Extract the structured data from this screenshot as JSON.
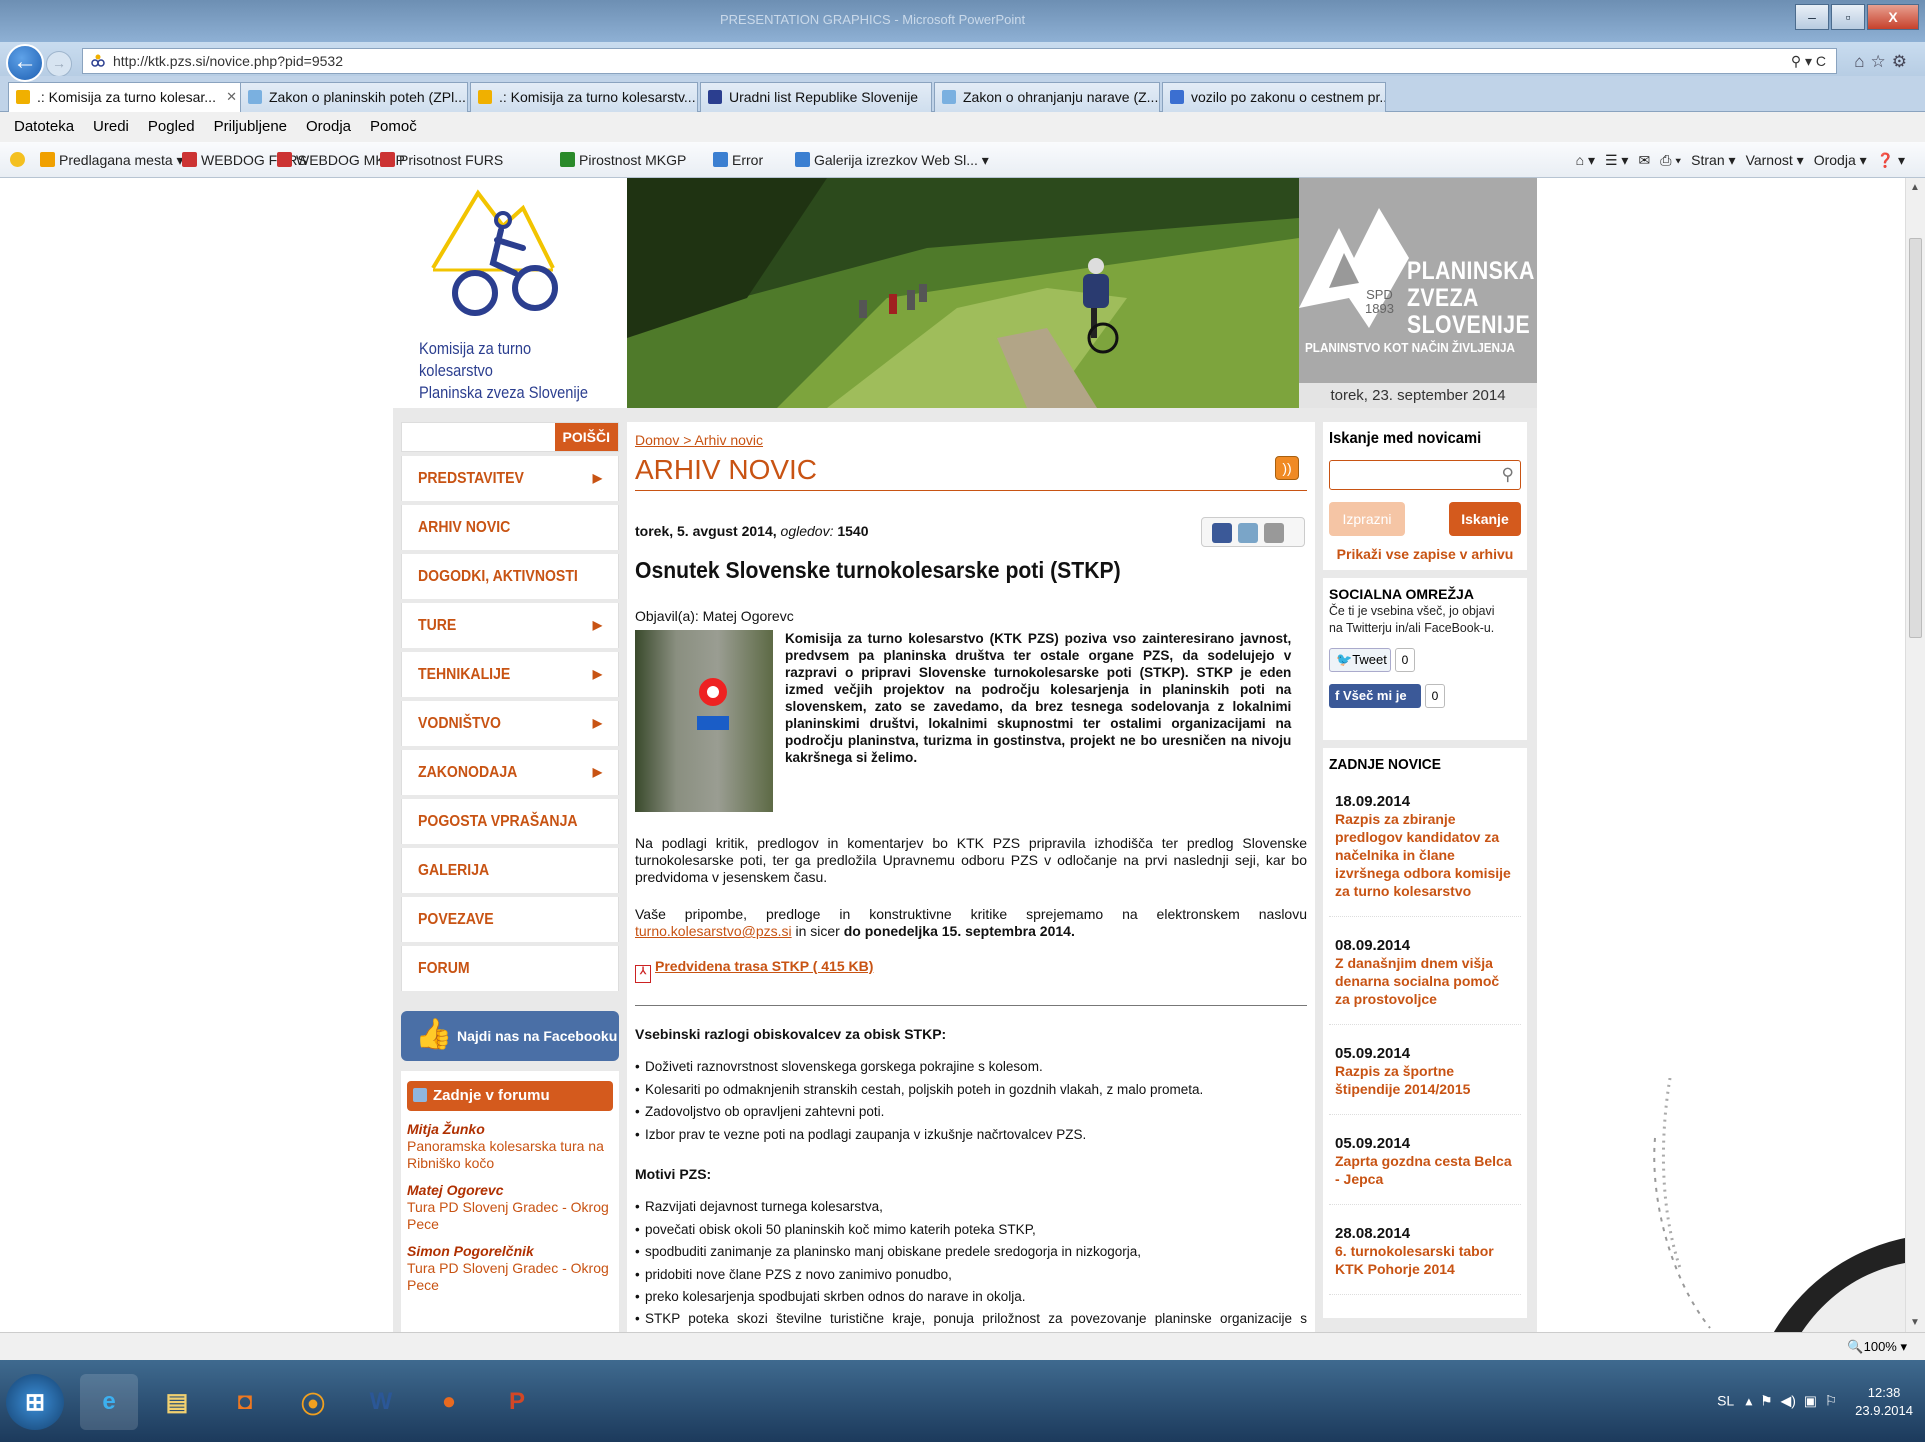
{
  "window": {
    "title": "PRESENTATION GRAPHICS - Microsoft PowerPoint"
  },
  "address": {
    "url": "http://ktk.pzs.si/novice.php?pid=9532",
    "controls": "⚲ ▾ C"
  },
  "tabs": [
    {
      "label": ".: Komisija za turno kolesar...",
      "color": "#f0b000"
    },
    {
      "label": "Zakon o planinskih poteh (ZPl...",
      "color": "#7ab0e0"
    },
    {
      "label": ".: Komisija za turno kolesarstv...",
      "color": "#f0b000"
    },
    {
      "label": "Uradni list Republike Slovenije",
      "color": "#2b3e8f"
    },
    {
      "label": "Zakon o ohranjanju narave (Z...",
      "color": "#7ab0e0"
    },
    {
      "label": "vozilo po zakonu o cestnem pr...",
      "color": "#3b6fd1"
    }
  ],
  "menubar": [
    "Datoteka",
    "Uredi",
    "Pogled",
    "Priljubljene",
    "Orodja",
    "Pomoč"
  ],
  "favorites": [
    {
      "label": "Predlagana mesta ▾",
      "color": "#f0a000"
    },
    {
      "label": "WEBDOG FURS",
      "color": "#c33"
    },
    {
      "label": "WEBDOG MKGP",
      "color": "#c33"
    },
    {
      "label": "Prisotnost FURS",
      "color": "#c33"
    },
    {
      "label": "Pirostnost MKGP",
      "color": "#2a8a2a"
    },
    {
      "label": "Error",
      "color": "#3b7fd1"
    },
    {
      "label": "Galerija izrezkov Web Sl... ▾",
      "color": "#3b7fd1"
    }
  ],
  "toolbar_right": [
    "⌂ ▾",
    "☰ ▾",
    "✉",
    "⎙ ▾",
    "Stran ▾",
    "Varnost ▾",
    "Orodja ▾",
    "❓ ▾"
  ],
  "site": {
    "logo_line1": "Komisija za turno kolesarstvo",
    "logo_line2": "Planinska zveza Slovenije",
    "pzs_name": [
      "PLANINSKA",
      "ZVEZA",
      "SLOVENIJE"
    ],
    "spd": [
      "SPD",
      "1893"
    ],
    "pzs_slogan": "PLANINSTVO KOT NAČIN ŽIVLJENJA",
    "date": "torek, 23. september 2014",
    "search_button": "POIŠČI",
    "nav": [
      {
        "label": "PREDSTAVITEV",
        "arrow": "▶"
      },
      {
        "label": "ARHIV NOVIC",
        "arrow": ""
      },
      {
        "label": "DOGODKI, AKTIVNOSTI",
        "arrow": ""
      },
      {
        "label": "TURE",
        "arrow": "▶"
      },
      {
        "label": "TEHNIKALIJE",
        "arrow": "▶"
      },
      {
        "label": "VODNIŠTVO",
        "arrow": "▶"
      },
      {
        "label": "ZAKONODAJA",
        "arrow": "▶"
      },
      {
        "label": "POGOSTA VPRAŠANJA",
        "arrow": ""
      },
      {
        "label": "GALERIJA",
        "arrow": ""
      },
      {
        "label": "POVEZAVE",
        "arrow": ""
      },
      {
        "label": "FORUM",
        "arrow": ""
      }
    ],
    "facebook_box": "Najdi nas na Facebooku",
    "forum": {
      "title": "Zadnje v forumu",
      "posts": [
        {
          "author": "Mitja Žunko",
          "topic": [
            "Panoramska kolesarska tura na",
            "Ribniško kočo"
          ]
        },
        {
          "author": "Matej Ogorevc",
          "topic": [
            "Tura PD Slovenj Gradec - Okrog",
            "Pece"
          ]
        },
        {
          "author": "Simon Pogorelčnik",
          "topic": [
            "Tura PD Slovenj Gradec - Okrog",
            "Pece"
          ]
        }
      ]
    }
  },
  "article": {
    "breadcrumb_home": "Domov",
    "breadcrumb_sep": " > ",
    "breadcrumb_current": "Arhiv novic",
    "heading": "ARHIV NOVIC",
    "date": "torek, 5. avgust 2014",
    "views_label": "ogledov:",
    "views": "1540",
    "title": "Osnutek Slovenske turnokolesarske poti (STKP)",
    "author": "Objavil(a): Matej Ogorevc",
    "intro": "Komisija za turno kolesarstvo (KTK PZS) poziva vso zainteresirano javnost, predvsem pa planinska društva ter ostale organe PZS, da sodelujejo v razpravi o pripravi Slovenske turnokolesarske poti (STKP). STKP je eden izmed večjih projektov na področju kolesarjenja in planinskih poti na slovenskem, zato se zavedamo, da brez tesnega sodelovanja z lokalnimi planinskimi društvi, lokalnimi skupnostmi ter ostalimi organizacijami na področju planinstva, turizma in gostinstva, projekt ne bo uresničen na nivoju kakršnega si želimo.",
    "para1": "Na podlagi kritik, predlogov in komentarjev bo KTK PZS pripravila izhodišča ter predlog Slovenske turnokolesarske poti, ter ga predložila Upravnemu odboru PZS v odločanje na prvi naslednji seji, kar bo predvidoma v jesenskem času.",
    "para2_a": "Vaše pripombe, predloge in konstruktivne kritike sprejemamo na elektronskem naslovu ",
    "para2_email": "turno.kolesarstvo@pzs.si",
    "para2_b": " in sicer ",
    "para2_c": "do ponedeljka 15. septembra 2014.",
    "pdf_link": "Predvidena trasa STKP ( 415 KB)",
    "section1": "Vsebinski razlogi obiskovalcev za obisk STKP:",
    "list1": [
      "Doživeti raznovrstnost slovenskega gorskega pokrajine s kolesom.",
      "Kolesariti po odmaknjenih stranskih cestah, poljskih poteh in gozdnih vlakah, z malo prometa.",
      "Zadovoljstvo ob opravljeni zahtevni poti.",
      "Izbor prav te vezne poti na podlagi zaupanja v izkušnje načrtovalcev PZS."
    ],
    "section2": "Motivi PZS:",
    "list2": [
      "Razvijati dejavnost turnega kolesarstva,",
      "povečati obisk okoli 50 planinskih koč mimo katerih poteka STKP,",
      "spodbuditi zanimanje za planinsko manj obiskane predele sredogorja in nizkogorja,",
      "pridobiti nove člane PZS z novo zanimivo ponudbo,",
      "preko kolesarjenja spodbujati skrben odnos do narave in okolja.",
      "STKP poteka skozi številne turistične kraje, ponuja priložnost za povezovanje planinske organizacije s turističnim gospodarstvom in lokalnimi skupnostmi in občinami. Turni kolesarji so gostje z relativno visoko"
    ]
  },
  "sidebar": {
    "search_title": "Iskanje med novicami",
    "clear_button": "Izprazni",
    "search_button": "Iskanje",
    "archive_link": "Prikaži vse zapise v arhivu",
    "social_title": "SOCIALNA OMREŽJA",
    "social_desc": "Če ti je vsebina všeč, jo objavi na Twitterju in/ali FaceBook-u.",
    "tweet_label": "Tweet",
    "tweet_count": "0",
    "like_label": "Všeč mi je",
    "like_count": "0",
    "news_title": "ZADNJE NOVICE",
    "news": [
      {
        "date": "18.09.2014",
        "title": "Razpis za zbiranje predlogov kandidatov za načelnika in člane izvršnega odbora komisije za turno kolesarstvo"
      },
      {
        "date": "08.09.2014",
        "title": "Z današnjim dnem višja denarna socialna pomoč za prostovoljce"
      },
      {
        "date": "05.09.2014",
        "title": "Razpis za športne štipendije 2014/2015"
      },
      {
        "date": "05.09.2014",
        "title": "Zaprta gozdna cesta Belca - Jepca"
      },
      {
        "date": "28.08.2014",
        "title": "6. turnokolesarski tabor KTK Pohorje 2014"
      }
    ]
  },
  "statusbar": {
    "zoom": "🔍100%  ▾"
  },
  "taskbar": {
    "lang": "SL",
    "time": "12:38",
    "date": "23.9.2014"
  }
}
